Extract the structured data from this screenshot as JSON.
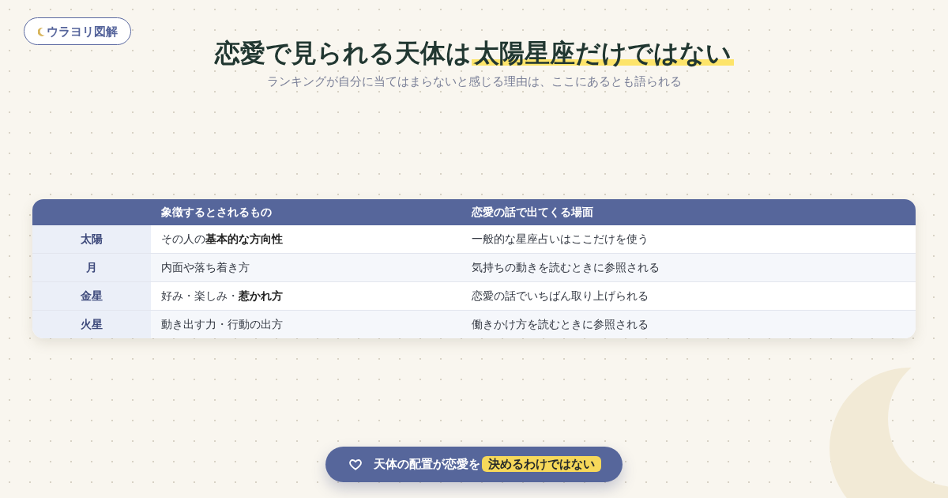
{
  "logo": {
    "text": "ウラヨリ図解"
  },
  "title": {
    "text": "恋愛で見られる天体は",
    "highlight": "太陽星座だけではない"
  },
  "subtitle": "ランキングが自分に当てはまらないと感じる理由は、ここにあるとも語られる",
  "table": {
    "columns": [
      "象徴するとされるもの",
      "恋愛の話で出てくる場面"
    ],
    "rows": [
      {
        "planet": "太陽",
        "symbol": "その人の**基本的な方向性**",
        "scene": "一般的な星座占いはここだけを使う"
      },
      {
        "planet": "月",
        "symbol": "内面や落ち着き方",
        "scene": "気持ちの動きを読むときに参照される"
      },
      {
        "planet": "金星",
        "symbol": "好み・楽しみ・**惹かれ方**",
        "scene": "恋愛の話でいちばん取り上げられる"
      },
      {
        "planet": "火星",
        "symbol": "動き出す力・行動の出方",
        "scene": "働きかけ方を読むときに参照される"
      }
    ]
  },
  "banner": {
    "text": "天体の配置が恋愛を",
    "highlight": "決めるわけではない"
  }
}
